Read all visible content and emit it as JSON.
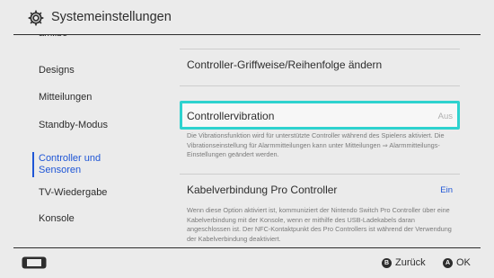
{
  "header": {
    "title": "Systemeinstellungen",
    "icon": "gear-icon"
  },
  "sidebar": {
    "partial_item": "amiibo",
    "items": [
      {
        "label": "Designs",
        "selected": false
      },
      {
        "label": "Mitteilungen",
        "selected": false
      },
      {
        "label": "Standby-Modus",
        "selected": false
      },
      {
        "label": "Controller und Sensoren",
        "line1": "Controller und",
        "line2": "Sensoren",
        "selected": true
      },
      {
        "label": "TV-Wiedergabe",
        "selected": false
      },
      {
        "label": "Konsole",
        "selected": false
      }
    ]
  },
  "main": {
    "grip_order": {
      "label": "Controller-Griffweise/Reihenfolge ändern"
    },
    "vibration": {
      "label": "Controllervibration",
      "value": "Aus",
      "description": "Die Vibrationsfunktion wird für unterstützte Controller während des Spielens aktiviert. Die Vibrationseinstellung für Alarmmitteilungen kann unter Mitteilungen ⇒ Alarmmitteilungs-Einstellungen geändert werden."
    },
    "pro_controller": {
      "label": "Kabelverbindung Pro Controller",
      "value": "Ein",
      "description": "Wenn diese Option aktiviert ist, kommuniziert der Nintendo Switch Pro Controller über eine Kabelverbindung mit der Konsole, wenn er mithilfe des USB-Ladekabels daran angeschlossen ist. Der NFC-Kontaktpunkt des Pro Controllers ist während der Verwendung der Kabelverbindung deaktiviert."
    }
  },
  "footer": {
    "back": {
      "button": "B",
      "label": "Zurück"
    },
    "ok": {
      "button": "A",
      "label": "OK"
    },
    "console_icon": "console-icon"
  },
  "colors": {
    "accent": "#1f56d6",
    "focus": "#2ed2cf",
    "value_on": "#1f56d6",
    "value_off": "#b0b0b0"
  }
}
